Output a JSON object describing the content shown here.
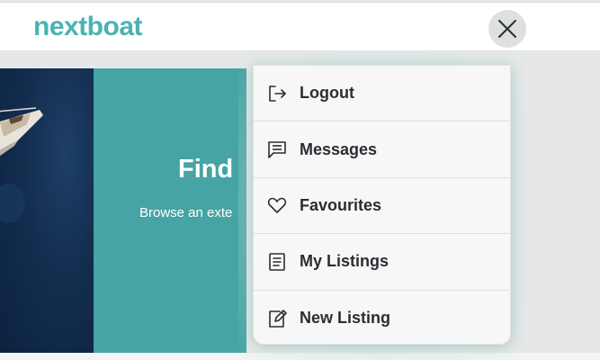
{
  "header": {
    "logo_text": "nextboat",
    "close_icon": "close-icon"
  },
  "hero": {
    "title": "Find",
    "subtitle": "Browse an exte"
  },
  "menu": {
    "items": [
      {
        "label": "Logout",
        "icon": "logout-icon"
      },
      {
        "label": "Messages",
        "icon": "messages-icon"
      },
      {
        "label": "Favourites",
        "icon": "heart-icon"
      },
      {
        "label": "My Listings",
        "icon": "listings-icon"
      },
      {
        "label": "New Listing",
        "icon": "new-listing-icon"
      }
    ]
  },
  "colors": {
    "brand": "#4ab3b1",
    "hero_panel": "#46a4a4",
    "hero_image": "#132d4f",
    "menu_bg": "#f7f7f7",
    "text": "#2a2e33"
  }
}
